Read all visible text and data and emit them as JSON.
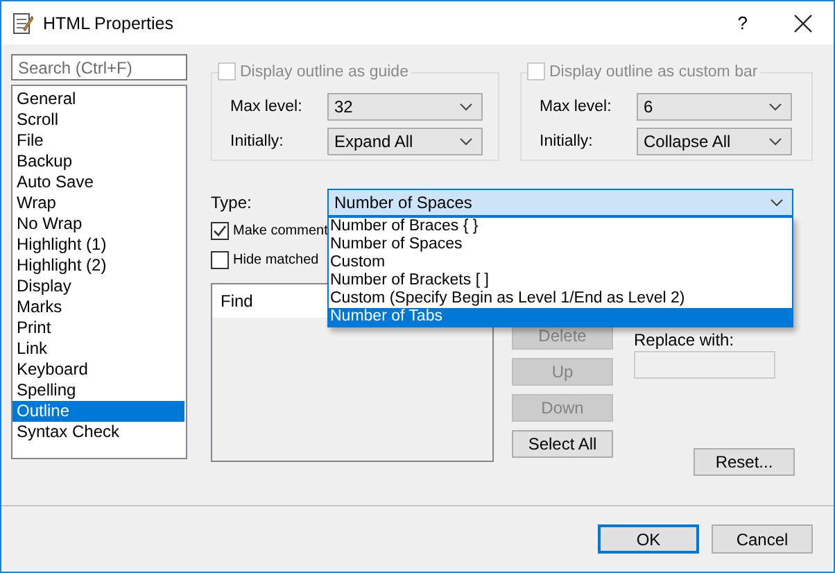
{
  "window": {
    "title": "HTML Properties",
    "help": "?"
  },
  "sidebar": {
    "search": {
      "placeholder": "Search (Ctrl+F)"
    },
    "items": [
      {
        "label": "General",
        "selected": false
      },
      {
        "label": "Scroll",
        "selected": false
      },
      {
        "label": "File",
        "selected": false
      },
      {
        "label": "Backup",
        "selected": false
      },
      {
        "label": "Auto Save",
        "selected": false
      },
      {
        "label": "Wrap",
        "selected": false
      },
      {
        "label": "No Wrap",
        "selected": false
      },
      {
        "label": "Highlight (1)",
        "selected": false
      },
      {
        "label": "Highlight (2)",
        "selected": false
      },
      {
        "label": "Display",
        "selected": false
      },
      {
        "label": "Marks",
        "selected": false
      },
      {
        "label": "Print",
        "selected": false
      },
      {
        "label": "Link",
        "selected": false
      },
      {
        "label": "Keyboard",
        "selected": false
      },
      {
        "label": "Spelling",
        "selected": false
      },
      {
        "label": "Outline",
        "selected": true
      },
      {
        "label": "Syntax Check",
        "selected": false
      }
    ]
  },
  "groups": [
    {
      "label": "Display outline as guide",
      "checked": false,
      "disabled": true,
      "max_level_label": "Max level:",
      "max_level": "32",
      "initially_label": "Initially:",
      "initially": "Expand All"
    },
    {
      "label": "Display outline as custom bar",
      "checked": false,
      "disabled": true,
      "max_level_label": "Max level:",
      "max_level": "6",
      "initially_label": "Initially:",
      "initially": "Collapse All"
    }
  ],
  "type": {
    "label": "Type:",
    "value": "Number of Spaces",
    "expanded": true,
    "options": [
      {
        "label": "Number of Braces { }",
        "highlighted": false
      },
      {
        "label": "Number of Spaces",
        "highlighted": false
      },
      {
        "label": "Custom",
        "highlighted": false
      },
      {
        "label": "Number of Brackets [ ]",
        "highlighted": false
      },
      {
        "label": "Custom (Specify Begin as Level 1/End as Level 2)",
        "highlighted": false
      },
      {
        "label": "Number of Tabs",
        "highlighted": true
      }
    ]
  },
  "checkboxes": [
    {
      "label": "Make comment",
      "checked": true
    },
    {
      "label": "Hide matched",
      "checked": false
    }
  ],
  "find_list": {
    "header": "Find"
  },
  "list_buttons": [
    {
      "label": "Delete",
      "disabled": true
    },
    {
      "label": "Up",
      "disabled": true
    },
    {
      "label": "Down",
      "disabled": true
    },
    {
      "label": "Select All",
      "disabled": false
    }
  ],
  "replace": {
    "label": "Replace with:"
  },
  "reset": "Reset...",
  "footer": [
    {
      "label": "OK",
      "default": true
    },
    {
      "label": "Cancel",
      "default": false
    }
  ]
}
